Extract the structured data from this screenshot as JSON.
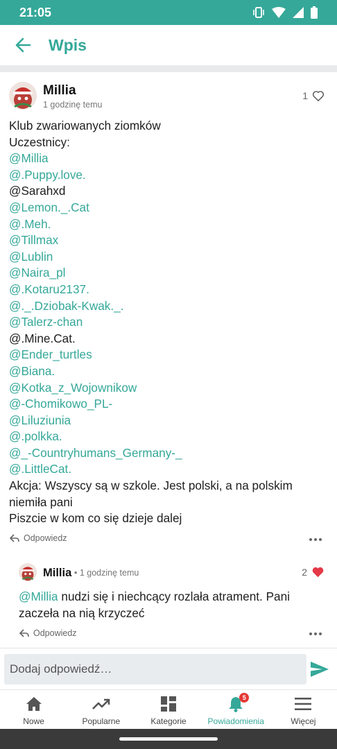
{
  "status_bar": {
    "time": "21:05",
    "icons": [
      "vibrate-icon",
      "wifi-icon",
      "signal-icon",
      "battery-icon"
    ]
  },
  "app_bar": {
    "title": "Wpis",
    "back_icon": "arrow-left-icon"
  },
  "post": {
    "author": "Millia",
    "time": "1 godzinę temu",
    "like_count": "1",
    "liked": false,
    "body_lines": [
      {
        "text": "Klub zwariowanych ziomków",
        "mention": false
      },
      {
        "text": "Uczestnicy:",
        "mention": false
      },
      {
        "text": "@Millia",
        "mention": true
      },
      {
        "text": "@.Puppy.love.",
        "mention": true
      },
      {
        "text": "@Sarahxd",
        "mention": false
      },
      {
        "text": "@Lemon._.Cat",
        "mention": true
      },
      {
        "text": "@.Meh.",
        "mention": true
      },
      {
        "text": "@Tillmax",
        "mention": true
      },
      {
        "text": "@Lublin",
        "mention": true
      },
      {
        "text": "@Naira_pl",
        "mention": true
      },
      {
        "text": "@.Kotaru2137.",
        "mention": true
      },
      {
        "text": "@._.Dziobak-Kwak._.",
        "mention": true
      },
      {
        "text": "@Talerz-chan",
        "mention": true
      },
      {
        "text": "@.Mine.Cat.",
        "mention": false
      },
      {
        "text": "@Ender_turtles",
        "mention": true
      },
      {
        "text": "@Biana.",
        "mention": true
      },
      {
        "text": "@Kotka_z_Wojownikow",
        "mention": true
      },
      {
        "text": "@-Chomikowo_PL-",
        "mention": true
      },
      {
        "text": "@Liluziunia",
        "mention": true
      },
      {
        "text": "@.polkka.",
        "mention": true
      },
      {
        "text": "@_-Countryhumans_Germany-_",
        "mention": true
      },
      {
        "text": "@.LittleCat.",
        "mention": true
      }
    ],
    "body_tail": "Akcja: Wszyscy są w szkole. Jest polski, a na polskim niemiła pani",
    "body_last": "Piszcie w kom co się dzieje dalej",
    "reply_label": "Odpowiedz"
  },
  "comment": {
    "author": "Millia",
    "time": "• 1 godzinę temu",
    "like_count": "2",
    "liked": true,
    "mention": "@Millia",
    "text": " nudzi się i niechcący rozlała atrament. Pani zaczeła na nią krzyczeć",
    "reply_label": "Odpowiedz"
  },
  "reply_input": {
    "placeholder": "Dodaj odpowiedź…",
    "value": ""
  },
  "bottom_nav": {
    "items": [
      {
        "label": "Nowe",
        "icon": "home-icon"
      },
      {
        "label": "Popularne",
        "icon": "trending-icon"
      },
      {
        "label": "Kategorie",
        "icon": "grid-icon"
      },
      {
        "label": "Powiadomienia",
        "icon": "bell-icon",
        "badge": "5",
        "active": true
      },
      {
        "label": "Więcej",
        "icon": "menu-icon"
      }
    ]
  },
  "colors": {
    "accent": "#35a899",
    "heart": "#e53948",
    "badge": "#e53935"
  }
}
